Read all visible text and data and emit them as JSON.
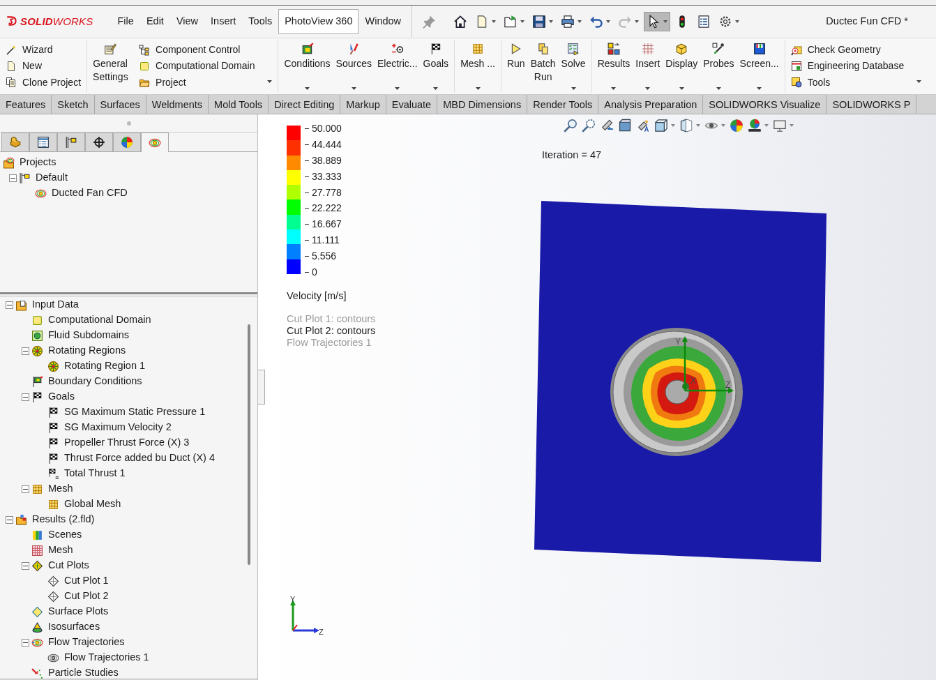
{
  "app": {
    "logo": "**SOLID**WORKS",
    "document_title": "Ductec Fun  CFD *"
  },
  "menu": [
    {
      "label": "File",
      "selected": false
    },
    {
      "label": "Edit",
      "selected": false
    },
    {
      "label": "View",
      "selected": false
    },
    {
      "label": "Insert",
      "selected": false
    },
    {
      "label": "Tools",
      "selected": false
    },
    {
      "label": "PhotoView 360",
      "selected": true
    },
    {
      "label": "Window",
      "selected": false
    }
  ],
  "quick_tools": [
    {
      "kind": "pin",
      "dropdown": false,
      "pressed": false
    },
    {
      "kind": "home",
      "dropdown": false,
      "pressed": false
    },
    {
      "kind": "new",
      "dropdown": true,
      "pressed": false
    },
    {
      "kind": "open",
      "dropdown": true,
      "pressed": false
    },
    {
      "kind": "save",
      "dropdown": true,
      "pressed": false
    },
    {
      "kind": "print",
      "dropdown": true,
      "pressed": false
    },
    {
      "kind": "undo",
      "dropdown": true,
      "pressed": false
    },
    {
      "kind": "redo",
      "dropdown": true,
      "pressed": false
    },
    {
      "kind": "select",
      "dropdown": true,
      "pressed": true
    },
    {
      "kind": "light",
      "dropdown": false,
      "pressed": false
    },
    {
      "kind": "list",
      "dropdown": false,
      "pressed": false
    },
    {
      "kind": "gear",
      "dropdown": true,
      "pressed": false
    }
  ],
  "ribbon": [
    {
      "kind": "stack",
      "items": [
        {
          "kind": "wizard",
          "label": "Wizard"
        },
        {
          "kind": "new",
          "label": "New"
        },
        {
          "kind": "clone",
          "label": "Clone Project"
        }
      ]
    },
    {
      "kind": "large",
      "items": [
        {
          "kind": "settings",
          "label": "General Settings",
          "dropdown": false
        }
      ]
    },
    {
      "kind": "stack",
      "dropdown": true,
      "items": [
        {
          "kind": "component",
          "label": "Component Control"
        },
        {
          "kind": "domain",
          "label": "Computational Domain"
        },
        {
          "kind": "project",
          "label": "Project"
        }
      ]
    },
    {
      "kind": "large",
      "items": [
        {
          "kind": "conditions",
          "label": "Conditions",
          "dropdown": true
        },
        {
          "kind": "sources",
          "label": "Sources",
          "dropdown": true
        },
        {
          "kind": "electric",
          "label": "Electric...",
          "dropdown": true
        },
        {
          "kind": "goals",
          "label": "Goals",
          "dropdown": true
        }
      ]
    },
    {
      "kind": "large",
      "items": [
        {
          "kind": "mesh",
          "label": "Mesh ...",
          "dropdown": true
        }
      ]
    },
    {
      "kind": "large",
      "items": [
        {
          "kind": "run",
          "label": "Run",
          "dropdown": false
        },
        {
          "kind": "batch",
          "label": "Batch Run",
          "dropdown": false
        },
        {
          "kind": "solve",
          "label": "Solve",
          "dropdown": true
        }
      ]
    },
    {
      "kind": "large",
      "items": [
        {
          "kind": "results",
          "label": "Results",
          "dropdown": true
        },
        {
          "kind": "insert",
          "label": "Insert",
          "dropdown": true
        },
        {
          "kind": "display",
          "label": "Display",
          "dropdown": true
        },
        {
          "kind": "probes",
          "label": "Probes",
          "dropdown": true
        },
        {
          "kind": "screen",
          "label": "Screen...",
          "dropdown": true
        }
      ]
    },
    {
      "kind": "stack",
      "dropdown": true,
      "items": [
        {
          "kind": "check",
          "label": "Check Geometry"
        },
        {
          "kind": "database",
          "label": "Engineering Database"
        },
        {
          "kind": "tools",
          "label": "Tools"
        }
      ]
    }
  ],
  "command_tabs": [
    "Features",
    "Sketch",
    "Surfaces",
    "Weldments",
    "Mold Tools",
    "Direct Editing",
    "Markup",
    "Evaluate",
    "MBD Dimensions",
    "Render Tools",
    "Analysis Preparation",
    "SOLIDWORKS Visualize",
    "SOLIDWORKS P"
  ],
  "panel_tabs": [
    {
      "kind": "part",
      "selected": false
    },
    {
      "kind": "property",
      "selected": false
    },
    {
      "kind": "config",
      "selected": false
    },
    {
      "kind": "dim",
      "selected": false
    },
    {
      "kind": "appearance",
      "selected": false
    },
    {
      "kind": "cfd",
      "selected": true
    }
  ],
  "projects_tree": [
    {
      "kind": "projects",
      "label": "Projects",
      "children": [
        {
          "kind": "config",
          "label": "Default",
          "expanded": true,
          "children": [
            {
              "kind": "cfd",
              "label": "Ducted Fan CFD"
            }
          ]
        }
      ]
    }
  ],
  "analysis_tree": [
    {
      "kind": "folder",
      "label": "Input Data",
      "expanded": true,
      "children": [
        {
          "kind": "domain",
          "label": "Computational Domain"
        },
        {
          "kind": "subdomain",
          "label": "Fluid Subdomains"
        },
        {
          "kind": "rotating",
          "label": "Rotating Regions",
          "expanded": true,
          "children": [
            {
              "kind": "rotating",
              "label": "Rotating Region 1"
            }
          ]
        },
        {
          "kind": "bc",
          "label": "Boundary Conditions"
        },
        {
          "kind": "goals",
          "label": "Goals",
          "expanded": true,
          "children": [
            {
              "kind": "goal",
              "label": "SG Maximum Static Pressure 1"
            },
            {
              "kind": "goal",
              "label": "SG Maximum Velocity 2"
            },
            {
              "kind": "goal",
              "label": "Propeller Thrust Force (X) 3"
            },
            {
              "kind": "goal",
              "label": "Thrust Force added bu Duct (X) 4"
            },
            {
              "kind": "eqgoal",
              "label": "Total Thrust 1"
            }
          ]
        },
        {
          "kind": "mesh",
          "label": "Mesh",
          "expanded": true,
          "children": [
            {
              "kind": "mesh",
              "label": "Global Mesh"
            }
          ]
        }
      ]
    },
    {
      "kind": "results",
      "label": "Results (2.fld)",
      "expanded": true,
      "children": [
        {
          "kind": "scenes",
          "label": "Scenes"
        },
        {
          "kind": "meshgrid",
          "label": "Mesh"
        },
        {
          "kind": "cutplots",
          "label": "Cut Plots",
          "expanded": true,
          "children": [
            {
              "kind": "cutplot",
              "label": "Cut Plot 1"
            },
            {
              "kind": "cutplot",
              "label": "Cut Plot 2"
            }
          ]
        },
        {
          "kind": "surface",
          "label": "Surface Plots"
        },
        {
          "kind": "iso",
          "label": "Isosurfaces"
        },
        {
          "kind": "flow",
          "label": "Flow Trajectories",
          "expanded": true,
          "children": [
            {
              "kind": "flowitem",
              "label": "Flow Trajectories 1"
            }
          ]
        },
        {
          "kind": "particle",
          "label": "Particle Studies"
        }
      ]
    }
  ],
  "view_tools": [
    {
      "kind": "zoomfit",
      "dropdown": false
    },
    {
      "kind": "zoomarea",
      "dropdown": false
    },
    {
      "kind": "previous",
      "dropdown": false
    },
    {
      "kind": "section",
      "dropdown": false
    },
    {
      "kind": "dynamic",
      "dropdown": false
    },
    {
      "kind": "orientation",
      "dropdown": true
    },
    {
      "kind": "style",
      "dropdown": true
    },
    {
      "kind": "hide",
      "dropdown": true
    },
    {
      "kind": "appearance",
      "dropdown": false
    },
    {
      "kind": "scene",
      "dropdown": true
    },
    {
      "kind": "monitor",
      "dropdown": true
    }
  ],
  "legend": {
    "labels": [
      "50.000",
      "44.444",
      "38.889",
      "33.333",
      "27.778",
      "22.222",
      "16.667",
      "11.111",
      "5.556",
      "0"
    ],
    "title": "Velocity [m/s]"
  },
  "plots": [
    {
      "label": "Cut Plot 1: contours",
      "visible": false
    },
    {
      "label": "Cut Plot 2: contours",
      "visible": true
    },
    {
      "label": "Flow Trajectories 1",
      "visible": false
    }
  ],
  "iteration": "Iteration = 47",
  "model_axis_labels": [
    "Y",
    "X",
    "Z"
  ],
  "triad_labels": [
    "Y",
    "Z"
  ]
}
